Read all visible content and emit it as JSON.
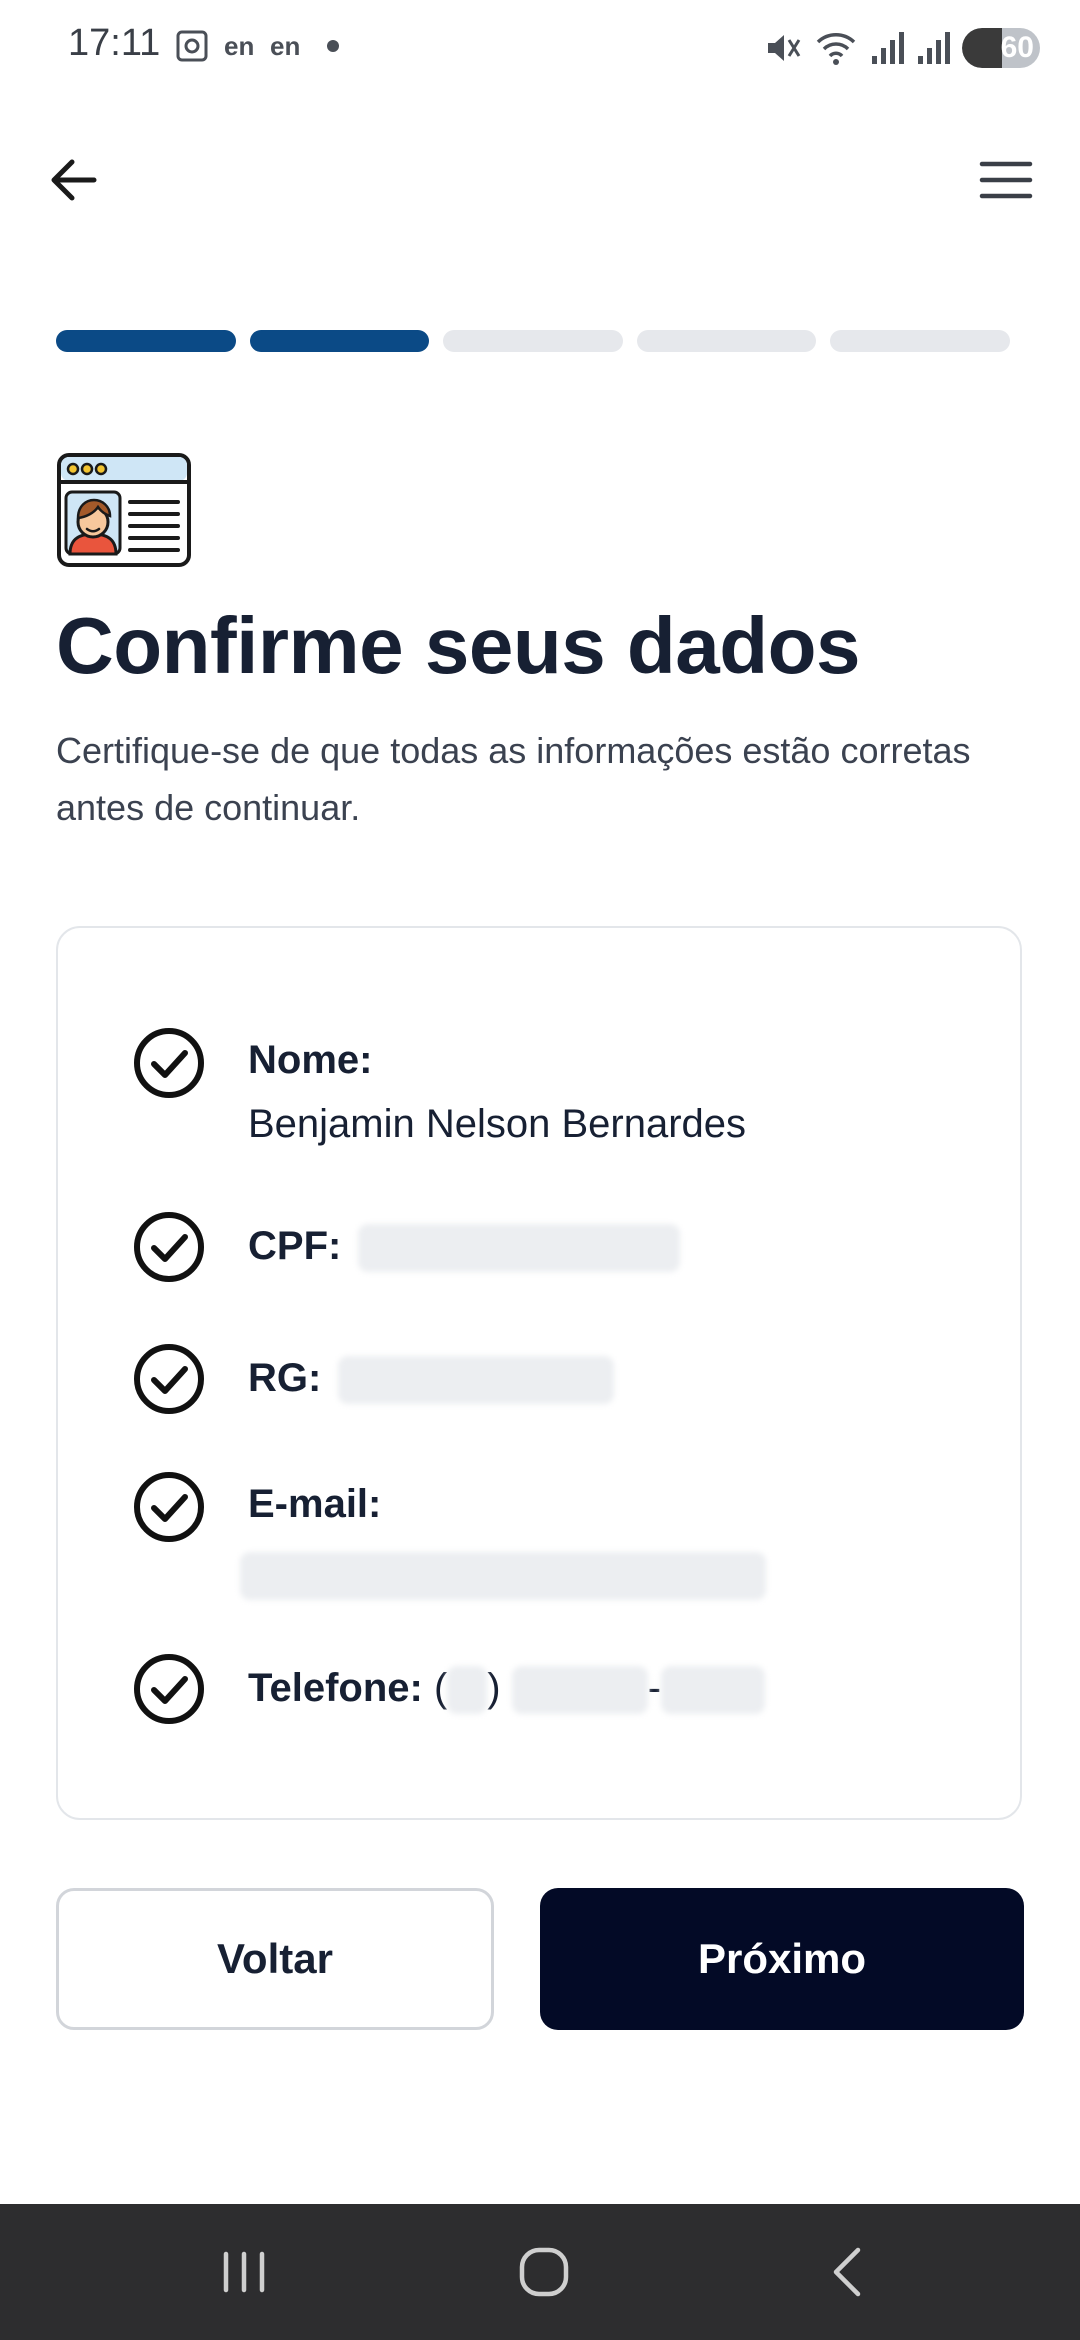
{
  "status_bar": {
    "time": "17:11",
    "lang1": "en",
    "lang2": "en",
    "battery": "60"
  },
  "progress": {
    "total_steps": 5,
    "completed_steps": 2
  },
  "header": {
    "title": "Confirme seus dados",
    "subtitle": "Certifique-se de que todas as informações estão corretas antes de continuar."
  },
  "details": {
    "name_label": "Nome:",
    "name_value": "Benjamin Nelson Bernardes",
    "cpf_label": "CPF:",
    "rg_label": "RG:",
    "email_label": "E-mail:",
    "phone_label": "Telefone:",
    "phone_open": "(",
    "phone_close": ")",
    "phone_dash": "-"
  },
  "buttons": {
    "back": "Voltar",
    "next": "Próximo"
  },
  "colors": {
    "progress_done": "#0b4a86",
    "progress_todo": "#e6e8ec",
    "primary_button": "#030a26"
  }
}
